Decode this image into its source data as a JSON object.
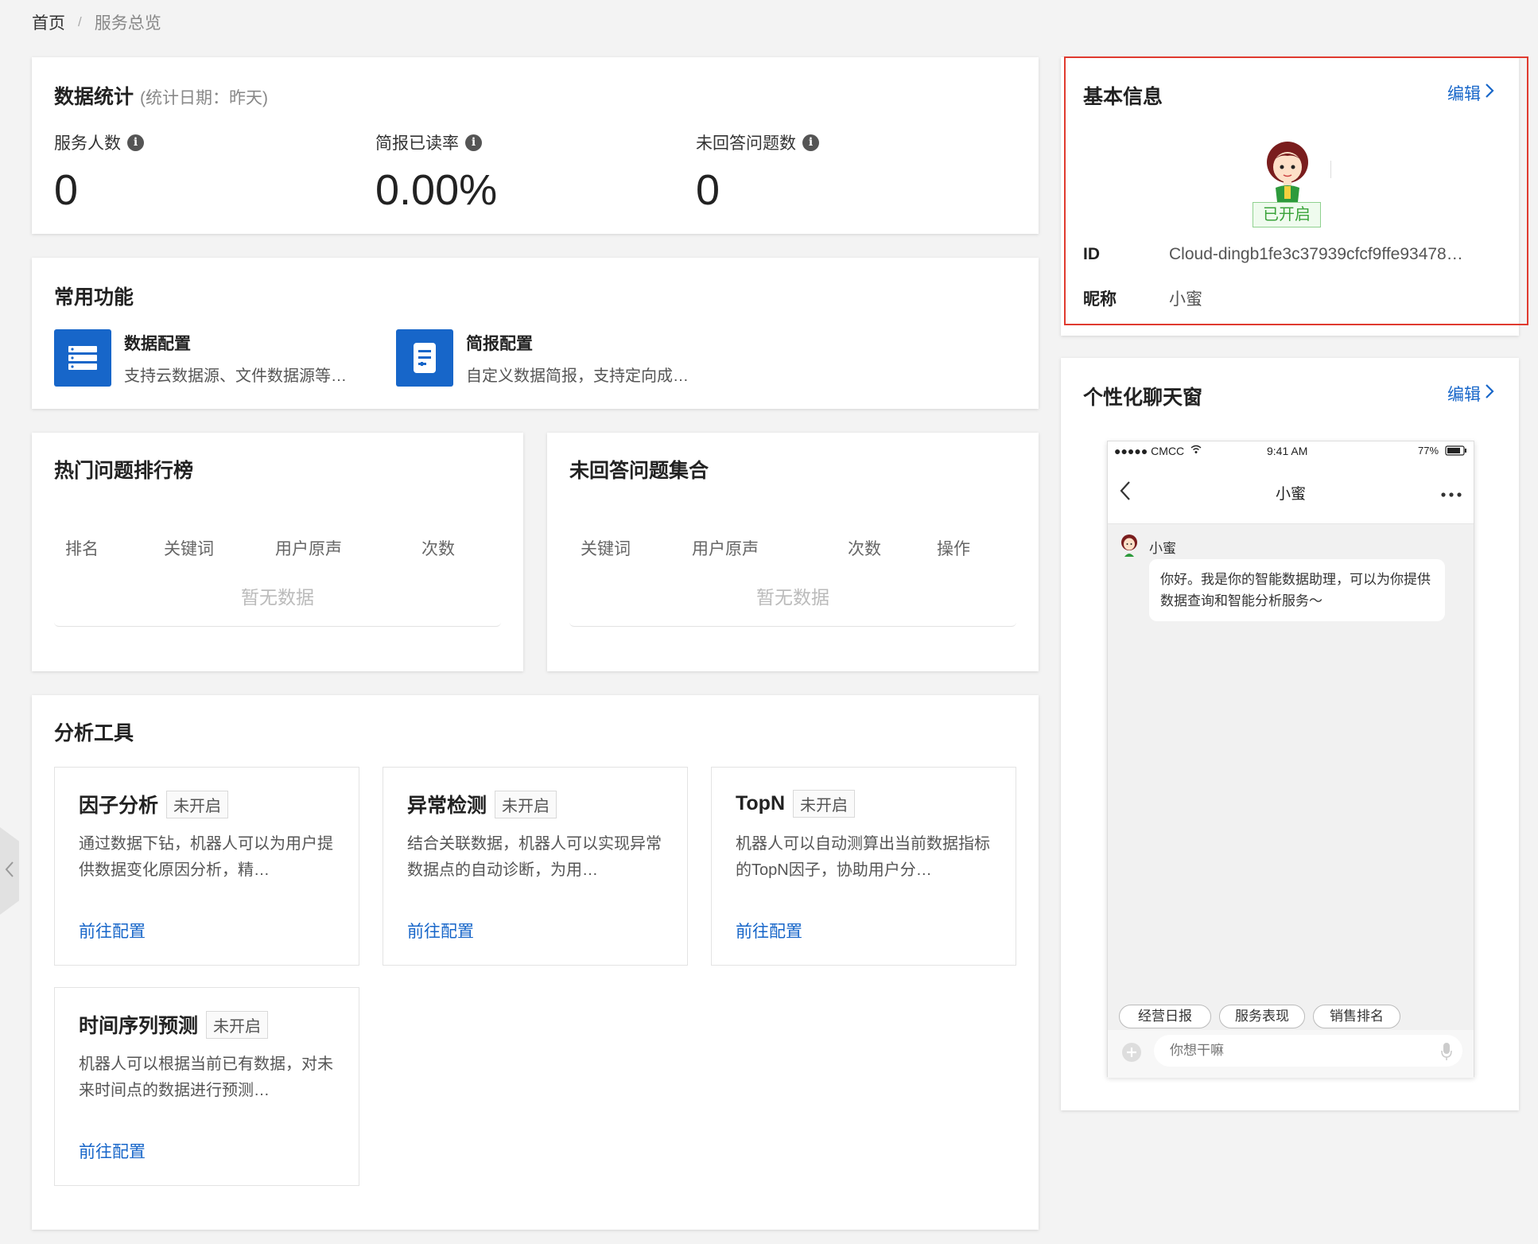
{
  "breadcrumb": {
    "home": "首页",
    "separator": "/",
    "current": "服务总览"
  },
  "stats": {
    "title": "数据统计",
    "subtitle": "(统计日期：昨天)",
    "items": [
      {
        "label": "服务人数",
        "value": "0"
      },
      {
        "label": "简报已读率",
        "value": "0.00%"
      },
      {
        "label": "未回答问题数",
        "value": "0"
      }
    ]
  },
  "common": {
    "title": "常用功能",
    "items": [
      {
        "name": "数据配置",
        "desc": "支持云数据源、文件数据源等…",
        "icon": "list-icon"
      },
      {
        "name": "简报配置",
        "desc": "自定义数据简报，支持定向成…",
        "icon": "document-icon"
      }
    ]
  },
  "hot": {
    "title": "热门问题排行榜",
    "columns": [
      "排名",
      "关键词",
      "用户原声",
      "次数"
    ],
    "empty": "暂无数据"
  },
  "unanswered": {
    "title": "未回答问题集合",
    "columns": [
      "关键词",
      "用户原声",
      "次数",
      "操作"
    ],
    "empty": "暂无数据"
  },
  "tools": {
    "title": "分析工具",
    "link_label": "前往配置",
    "items": [
      {
        "name": "因子分析",
        "badge": "未开启",
        "desc": "通过数据下钻，机器人可以为用户提供数据变化原因分析，精…"
      },
      {
        "name": "异常检测",
        "badge": "未开启",
        "desc": "结合关联数据，机器人可以实现异常数据点的自动诊断，为用…"
      },
      {
        "name": "TopN",
        "badge": "未开启",
        "desc": "机器人可以自动测算出当前数据指标的TopN因子，协助用户分…"
      },
      {
        "name": "时间序列预测",
        "badge": "未开启",
        "desc": "机器人可以根据当前已有数据，对未来时间点的数据进行预测…"
      }
    ]
  },
  "basic": {
    "title": "基本信息",
    "edit": "编辑",
    "status": "已开启",
    "id_label": "ID",
    "id_value": "Cloud-dingb1fe3c37939cfcf9ffe93478…",
    "nick_label": "昵称",
    "nick_value": "小蜜"
  },
  "chat": {
    "title": "个性化聊天窗",
    "edit": "编辑",
    "phone": {
      "carrier": "●●●●● CMCC",
      "time": "9:41 AM",
      "battery": "77%",
      "nav_title": "小蜜",
      "bot_name": "小蜜",
      "message": "你好。我是你的智能数据助理，可以为你提供数据查询和智能分析服务～",
      "quick_replies": [
        "经营日报",
        "服务表现",
        "销售排名"
      ],
      "input_placeholder": "你想干嘛"
    }
  },
  "colors": {
    "accent": "#1766c9",
    "highlight_frame": "#e03a2f",
    "status_on": "#3aa33a"
  }
}
